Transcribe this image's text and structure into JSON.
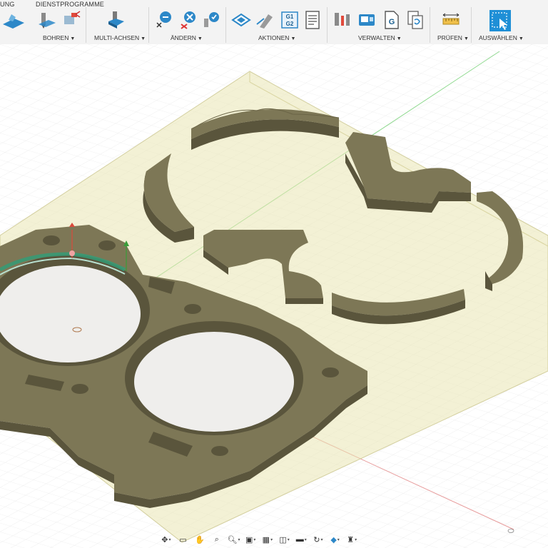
{
  "tabs": {
    "partial": "UNG",
    "utilities": "DIENSTPROGRAMME"
  },
  "groups": {
    "drilling": "BOHREN",
    "multiaxis": "MULTI-ACHSEN",
    "modify": "ÄNDERN",
    "actions": "AKTIONEN",
    "manage": "VERWALTEN",
    "inspect": "PRÜFEN",
    "select": "AUSWÄHLEN"
  },
  "icon_text": {
    "g1g2_top": "G1",
    "g1g2_bottom": "G2",
    "post_g": "G"
  },
  "icons": [
    "2d-adaptive-icon",
    "drill-icon",
    "probe-icon",
    "multiaxis-icon",
    "scissors-clear-icon",
    "delete-toolpath-icon",
    "fix-toolpath-icon",
    "simulate-icon",
    "generate-icon",
    "post-process-icon",
    "setup-sheet-icon",
    "tool-library-icon",
    "machine-library-icon",
    "post-library-icon",
    "templates-icon",
    "measure-icon",
    "select-icon"
  ],
  "colors": {
    "accent": "#1f8fd6",
    "stock": "#e9e5b3",
    "part_top": "#7d7756",
    "part_side": "#5a553c",
    "toolpath": "#2f9d78"
  },
  "navbar": [
    "orbit-icon",
    "look-at-icon",
    "pan-icon",
    "zoom-fit-icon",
    "zoom-icon",
    "display-icon",
    "grid-icon",
    "viewports-icon",
    "layout-icon",
    "orbit-mode-icon",
    "shading-icon",
    "effects-icon"
  ]
}
